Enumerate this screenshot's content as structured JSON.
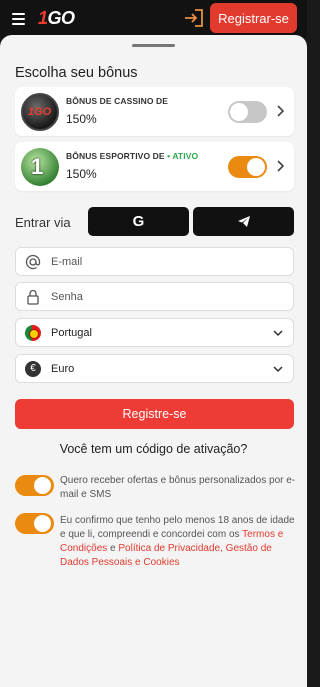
{
  "header": {
    "logo_one": "1",
    "logo_go": "GO",
    "register_label": "Registrar-se",
    "menu_icon": "menu-icon",
    "login_icon": "login-icon"
  },
  "sheet": {
    "title": "Escolha seu bônus",
    "bonuses": [
      {
        "label": "BÔNUS DE CASSINO DE",
        "percent": "150%",
        "status": "",
        "enabled": false,
        "image": "1GO"
      },
      {
        "label": "BÔNUS ESPORTIVO DE",
        "status_dot": "•",
        "status": "ATIVO",
        "percent": "150%",
        "enabled": true,
        "image": "1"
      }
    ]
  },
  "social": {
    "label": "Entrar via",
    "google_icon": "G",
    "telegram_icon": "telegram-icon"
  },
  "form": {
    "email_placeholder": "E-mail",
    "password_placeholder": "Senha",
    "country_value": "Portugal",
    "currency_value": "Euro",
    "currency_symbol": "€",
    "submit_label": "Registre-se",
    "activation_code": "Você tem um código de ativação?"
  },
  "consents": {
    "offers_text": "Quero receber ofertas e bônus personalizados por e-mail e SMS",
    "age_text": "Eu confirmo que tenho pelo menos 18 anos de idade e que li, compreendi e concordei com os",
    "terms_link": "Termos e Condições",
    "and_text": "e",
    "privacy_link": "Política de Privacidade, Gestão de Dados Pessoais e Cookies"
  },
  "colors": {
    "accent": "#e33a2e",
    "toggle_on": "#ea8a10",
    "status_active": "#2ea84a"
  }
}
